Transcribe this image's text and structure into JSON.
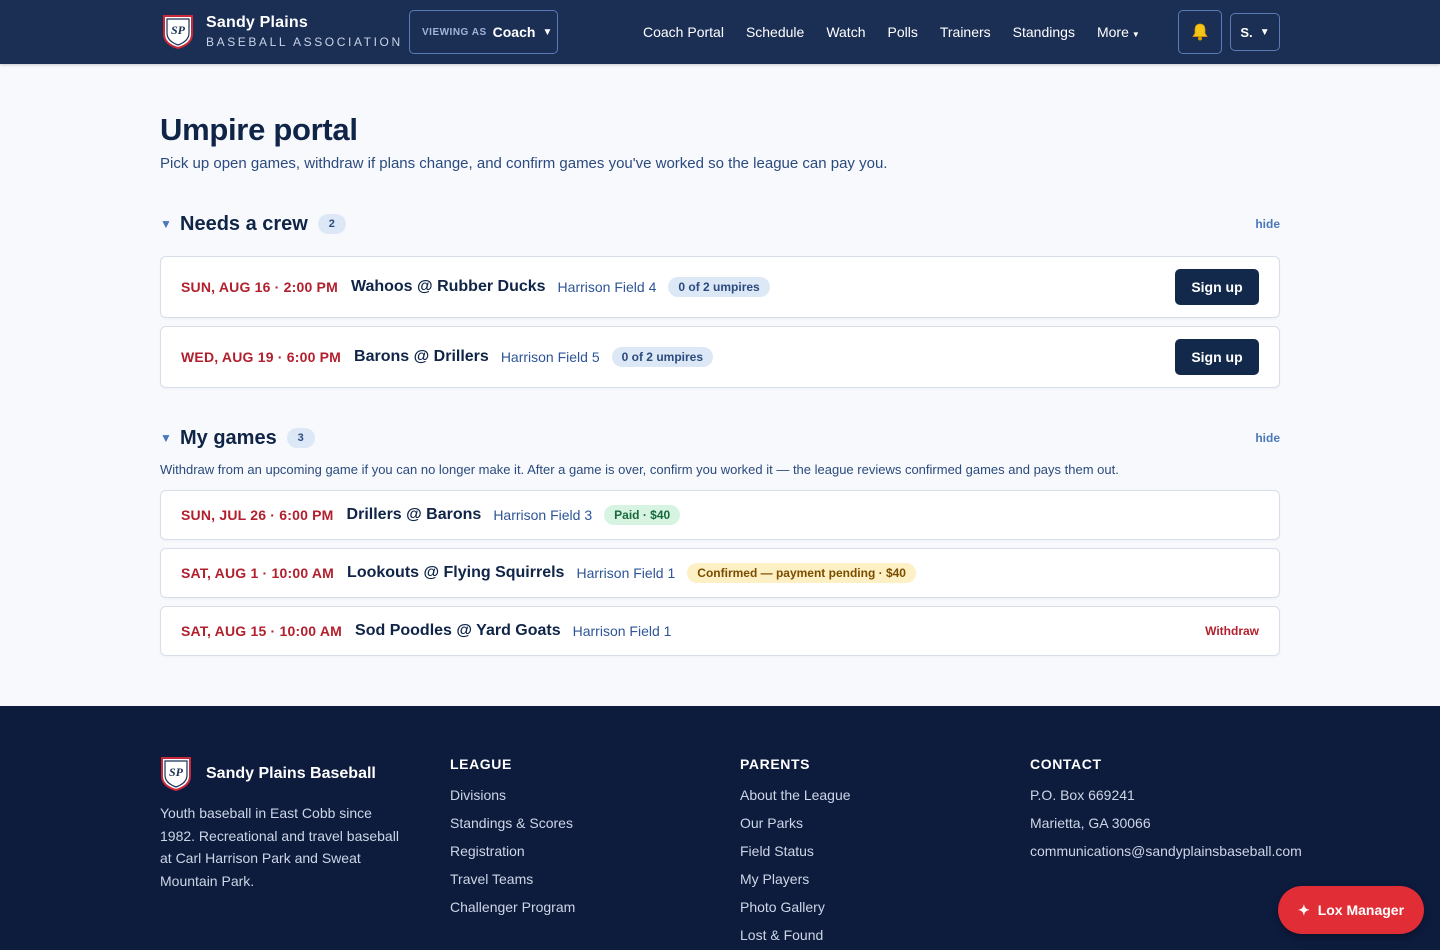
{
  "header": {
    "brand_name": "Sandy Plains",
    "brand_sub": "BASEBALL ASSOCIATION",
    "logo_text": "SP",
    "viewing_label": "VIEWING AS",
    "viewing_role": "Coach",
    "nav": [
      "Coach Portal",
      "Schedule",
      "Watch",
      "Polls",
      "Trainers",
      "Standings",
      "More"
    ],
    "user_initial": "S.",
    "bell_icon": "bell-icon"
  },
  "page": {
    "title": "Umpire portal",
    "subtitle": "Pick up open games, withdraw if plans change, and confirm games you've worked so the league can pay you."
  },
  "needs_crew": {
    "title": "Needs a crew",
    "count": "2",
    "hide_label": "hide",
    "games": [
      {
        "when": "SUN, AUG 16 · 2:00 PM",
        "match": "Wahoos @ Rubber Ducks",
        "field": "Harrison Field 4",
        "badge": "0 of 2 umpires",
        "action": "Sign up"
      },
      {
        "when": "WED, AUG 19 · 6:00 PM",
        "match": "Barons @ Drillers",
        "field": "Harrison Field 5",
        "badge": "0 of 2 umpires",
        "action": "Sign up"
      }
    ]
  },
  "my_games": {
    "title": "My games",
    "count": "3",
    "hide_label": "hide",
    "note": "Withdraw from an upcoming game if you can no longer make it. After a game is over, confirm you worked it — the league reviews confirmed games and pays them out.",
    "games": [
      {
        "when": "SUN, JUL 26 · 6:00 PM",
        "match": "Drillers @ Barons",
        "field": "Harrison Field 3",
        "badge": "Paid · $40"
      },
      {
        "when": "SAT, AUG 1 · 10:00 AM",
        "match": "Lookouts @ Flying Squirrels",
        "field": "Harrison Field 1",
        "badge": "Confirmed — payment pending · $40"
      },
      {
        "when": "SAT, AUG 15 · 10:00 AM",
        "match": "Sod Poodles @ Yard Goats",
        "field": "Harrison Field 1",
        "action": "Withdraw"
      }
    ]
  },
  "footer": {
    "brand_name": "Sandy Plains Baseball",
    "description": "Youth baseball in East Cobb since 1982. Recreational and travel baseball at Carl Harrison Park and Sweat Mountain Park.",
    "league": {
      "title": "LEAGUE",
      "links": [
        "Divisions",
        "Standings & Scores",
        "Registration",
        "Travel Teams",
        "Challenger Program"
      ]
    },
    "parents": {
      "title": "PARENTS",
      "links": [
        "About the League",
        "Our Parks",
        "Field Status",
        "My Players",
        "Photo Gallery",
        "Lost & Found"
      ]
    },
    "contact": {
      "title": "CONTACT",
      "lines": [
        "P.O. Box 669241",
        "Marietta, GA 30066",
        "communications@sandyplainsbaseball.com"
      ]
    }
  },
  "fab": {
    "label": "Lox Manager"
  },
  "colors": {
    "navy": "#1b2f55",
    "footer": "#0d1b3d",
    "accent_red": "#b21f2d",
    "fab_red": "#e02d36"
  }
}
